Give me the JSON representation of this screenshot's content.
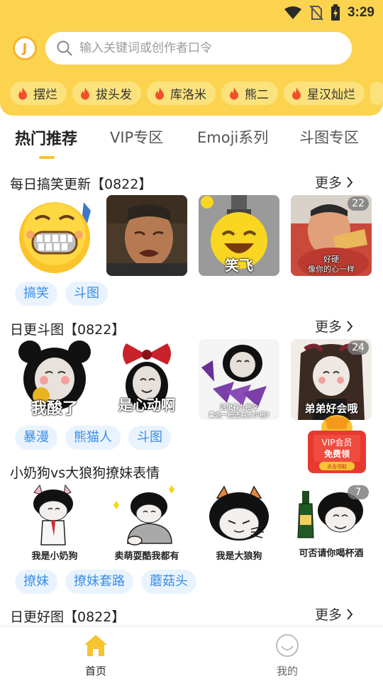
{
  "status_bar": {
    "time": "3:29"
  },
  "search": {
    "placeholder": "输入关键词或创作者口令",
    "logo_text": "J"
  },
  "hot_tags": [
    "摆烂",
    "拔头发",
    "库洛米",
    "熊二",
    "星汉灿烂"
  ],
  "tabs": [
    {
      "label": "热门推荐",
      "active": true
    },
    {
      "label": "VIP专区",
      "active": false
    },
    {
      "label": "Emoji系列",
      "active": false
    },
    {
      "label": "斗图专区",
      "active": false
    }
  ],
  "more_label": "更多",
  "sections": [
    {
      "title": "每日搞笑更新【0822】",
      "items": [
        {
          "icon": "grimace-emoji-sticker",
          "caption": ""
        },
        {
          "icon": "crying-old-man-photo",
          "caption": ""
        },
        {
          "icon": "laughing-emoji-sticker",
          "caption": "笑飞"
        },
        {
          "icon": "eating-man-photo",
          "caption_line1": "好硬",
          "caption_line2": "像你的心一样",
          "count": "22"
        }
      ],
      "tags": [
        "搞笑",
        "斗图"
      ]
    },
    {
      "title": "日更斗图【0822】",
      "items": [
        {
          "icon": "panda-meme-sticker",
          "caption": "我酸了"
        },
        {
          "icon": "bow-meme-sticker",
          "caption": "是心动啊"
        },
        {
          "icon": "panda-umbrella-sticker",
          "caption_line1": "这里有九把伞",
          "caption_line2": "拿走一把还有多少把?"
        },
        {
          "icon": "girl-meme-sticker",
          "caption": "弟弟好会哦",
          "count": "24"
        }
      ],
      "tags": [
        "暴漫",
        "熊猫人",
        "斗图"
      ]
    },
    {
      "title": "小奶狗vs大狼狗撩妹表情",
      "items": [
        {
          "icon": "mushroom-head-puppy-sticker",
          "caption": "我是小奶狗"
        },
        {
          "icon": "mushroom-head-cute-sticker",
          "caption": "卖萌耍酷我都有"
        },
        {
          "icon": "mushroom-head-wolf-sticker",
          "caption": "我是大狼狗"
        },
        {
          "icon": "mushroom-head-beer-sticker",
          "caption": "可否请你喝杯酒",
          "count": "7"
        }
      ],
      "tags": [
        "撩妹",
        "撩妹套路",
        "蘑菇头"
      ]
    },
    {
      "title": "日更好图【0822】"
    }
  ],
  "vip_promo": {
    "line1": "VIP会员",
    "line2": "免费领",
    "line3": "点击领取"
  },
  "bottom_nav": [
    {
      "label": "首页",
      "icon": "home-icon",
      "active": true
    },
    {
      "label": "我的",
      "icon": "profile-icon",
      "active": false
    }
  ],
  "colors": {
    "header": "#fbd34f",
    "accent": "#f7c32e",
    "tag_bg": "#e9f3fd",
    "tag_text": "#3a8ee6",
    "fire": "#f0502a"
  }
}
